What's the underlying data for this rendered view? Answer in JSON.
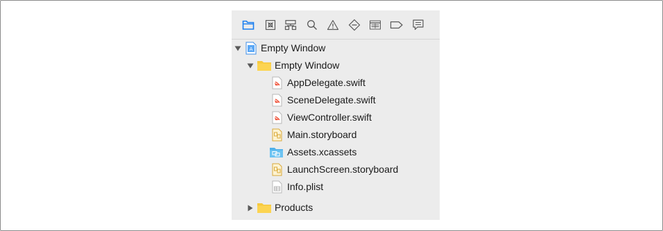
{
  "navigator": {
    "toolbar": {
      "tabs": [
        {
          "icon": "project-navigator-folder-icon",
          "selected": true
        },
        {
          "icon": "source-control-navigator-icon"
        },
        {
          "icon": "symbol-navigator-icon"
        },
        {
          "icon": "find-navigator-icon"
        },
        {
          "icon": "issue-navigator-icon"
        },
        {
          "icon": "test-navigator-icon"
        },
        {
          "icon": "debug-navigator-icon"
        },
        {
          "icon": "breakpoint-navigator-icon"
        },
        {
          "icon": "report-navigator-icon"
        }
      ]
    },
    "tree": {
      "project": {
        "label": "Empty Window",
        "icon": "xcode-project-icon",
        "expanded": true
      },
      "group": {
        "label": "Empty Window",
        "icon": "folder-icon",
        "expanded": true
      },
      "files": [
        {
          "label": "AppDelegate.swift",
          "icon": "swift-file-icon"
        },
        {
          "label": "SceneDelegate.swift",
          "icon": "swift-file-icon"
        },
        {
          "label": "ViewController.swift",
          "icon": "swift-file-icon"
        },
        {
          "label": "Main.storyboard",
          "icon": "storyboard-file-icon"
        },
        {
          "label": "Assets.xcassets",
          "icon": "asset-catalog-icon"
        },
        {
          "label": "LaunchScreen.storyboard",
          "icon": "storyboard-file-icon"
        },
        {
          "label": "Info.plist",
          "icon": "plist-file-icon"
        }
      ],
      "products": {
        "label": "Products",
        "icon": "folder-icon",
        "expanded": false
      }
    }
  },
  "colors": {
    "selected_tab": "#1a7ef0",
    "toolbar_icon": "#5a5a5a",
    "folder": "#f6c93f",
    "swift": "#f05138",
    "storyboard": "#e9b949",
    "assets": "#58b7ec",
    "panel_background": "#ececec"
  }
}
